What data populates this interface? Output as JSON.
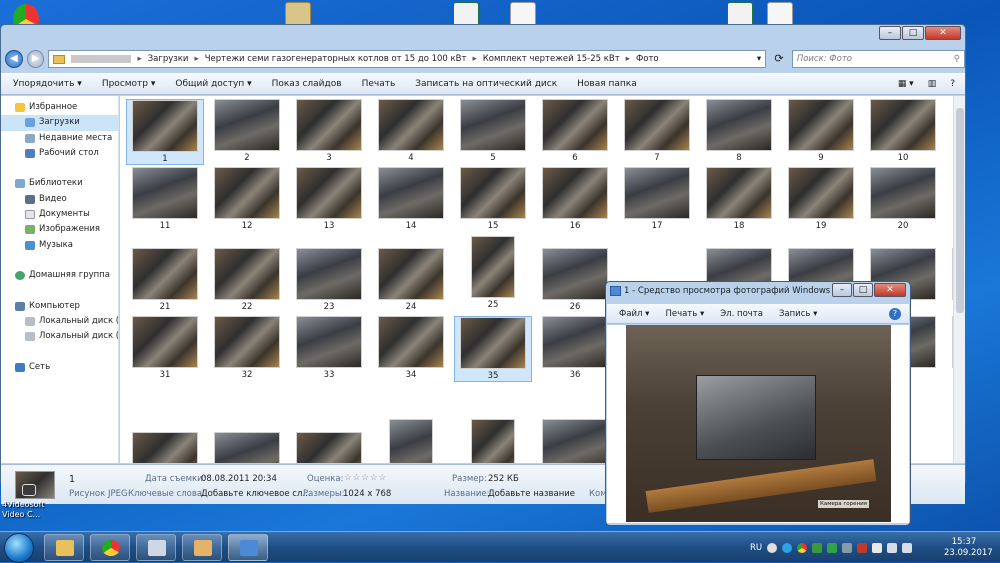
{
  "explorer": {
    "breadcrumbs": [
      "Загрузки",
      "Чертежи семи газогенераторных котлов от 15 до 100 кВт",
      "Комплект чертежей 15-25 кВт",
      "Фото"
    ],
    "search_placeholder": "Поиск: Фото",
    "toolbar": {
      "organize": "Упорядочить ▾",
      "preview": "Просмотр ▾",
      "share": "Общий доступ ▾",
      "slideshow": "Показ слайдов",
      "print": "Печать",
      "burn": "Записать на оптический диск",
      "new_folder": "Новая папка"
    },
    "nav": {
      "favorites": "Избранное",
      "downloads": "Загрузки",
      "recent": "Недавние места",
      "desktop": "Рабочий стол",
      "libraries": "Библиотеки",
      "video": "Видео",
      "documents": "Документы",
      "images": "Изображения",
      "music": "Музыка",
      "homegroup": "Домашняя группа",
      "computer": "Компьютер",
      "disk_c": "Локальный диск (C",
      "disk_d": "Локальный диск (D",
      "network": "Сеть"
    },
    "thumbnails": [
      "1",
      "2",
      "3",
      "4",
      "5",
      "6",
      "7",
      "8",
      "9",
      "10",
      "11",
      "12",
      "13",
      "14",
      "15",
      "16",
      "17",
      "18",
      "19",
      "20",
      "21",
      "22",
      "23",
      "24",
      "25",
      "26",
      "31",
      "32",
      "33",
      "34",
      "35",
      "36"
    ],
    "details": {
      "name": "1",
      "type": "Рисунок JPEG",
      "date_label": "Дата съемки:",
      "date_value": "08.08.2011 20:34",
      "keywords_label": "Ключевые слова:",
      "keywords_value": "Добавьте ключевое сл...",
      "rating_label": "Оценка:",
      "rating_stars": "☆☆☆☆☆",
      "dimensions_label": "Размеры:",
      "dimensions_value": "1024 x 768",
      "size_label": "Размер:",
      "size_value": "252 КБ",
      "title_label": "Название:",
      "title_value": "Добавьте название",
      "comments_cut": "Комм"
    }
  },
  "viewer": {
    "title": "1 - Средство просмотра фотографий Windows",
    "menu": {
      "file": "Файл ▾",
      "print": "Печать ▾",
      "email": "Эл. почта",
      "burn": "Запись ▾"
    },
    "photo_caption": "Камера горения"
  },
  "desktop": {
    "icon_label": "4Videosoft Video C..."
  },
  "taskbar": {
    "lang": "RU",
    "time": "15:37",
    "date": "23.09.2017"
  }
}
